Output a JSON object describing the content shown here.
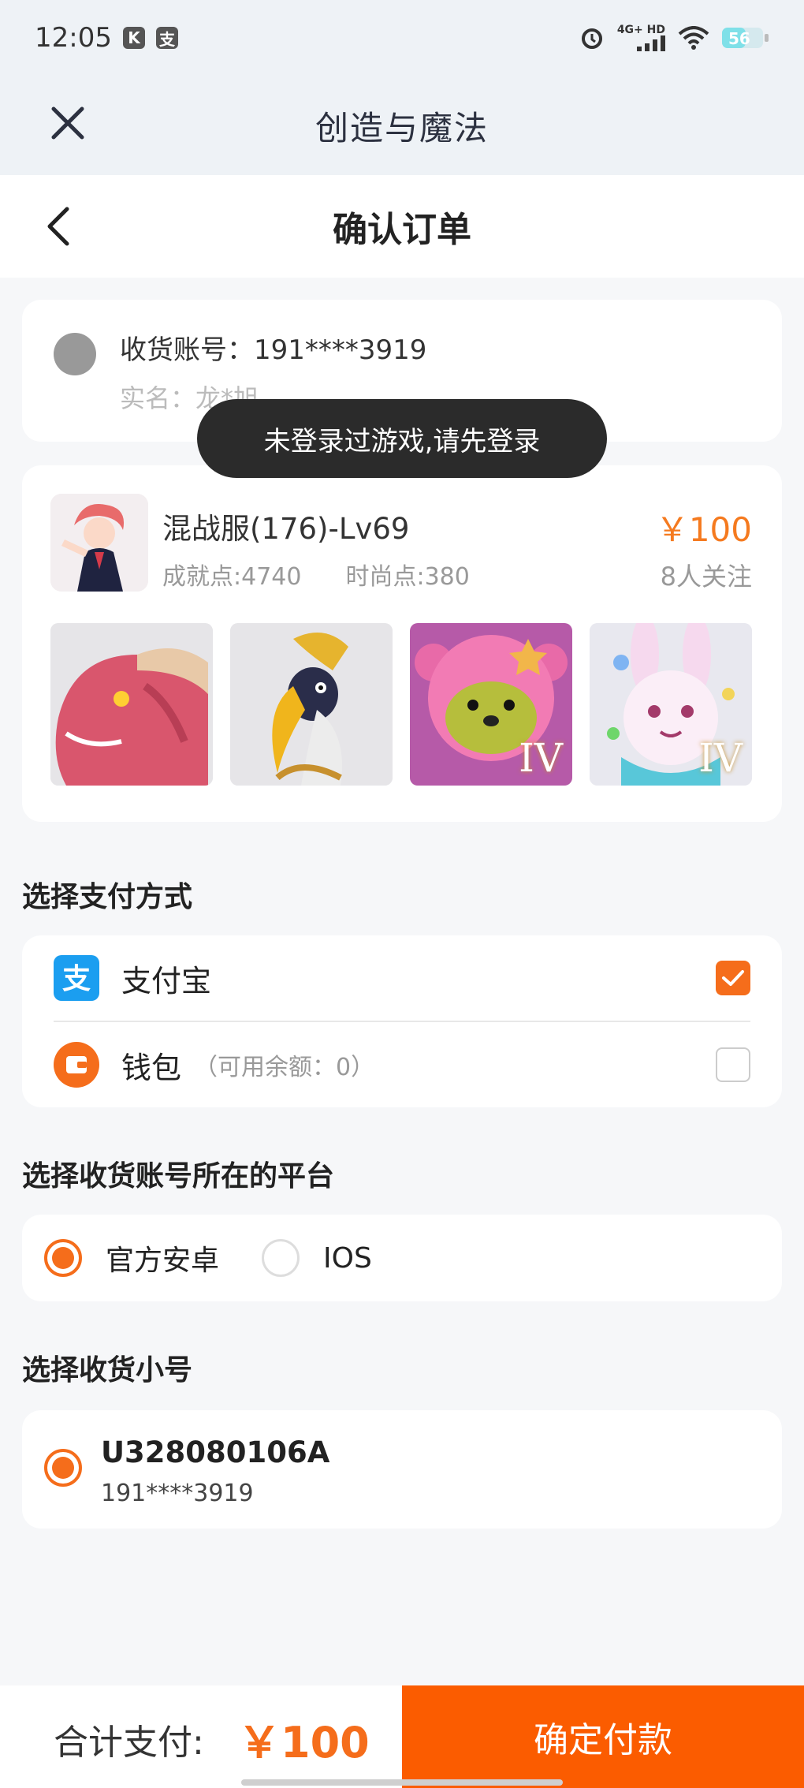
{
  "status_bar": {
    "time": "12:05",
    "badge_k": "K",
    "badge_pay": "支",
    "net_top": "4G+ HD",
    "battery": "56"
  },
  "app_bar": {
    "title": "创造与魔法"
  },
  "header": {
    "title": "确认订单"
  },
  "account": {
    "label": "收货账号：",
    "phone": "191****3919",
    "realname_label": "实名：",
    "realname": "龙*旭"
  },
  "toast": "未登录过游戏,请先登录",
  "product": {
    "name": "混战服(176)-Lv69",
    "achievement": "成就点:4740",
    "fashion": "时尚点:380",
    "price": "￥100",
    "followers": "8人关注",
    "tier_label": "IV",
    "thumb_icons": [
      "dragon-head-icon",
      "toucan-bird-icon",
      "pink-bear-icon",
      "bunny-icon"
    ]
  },
  "payment": {
    "section_title": "选择支付方式",
    "options": [
      {
        "label": "支付宝",
        "sub": "",
        "checked": true,
        "icon": "alipay-icon"
      },
      {
        "label": "钱包",
        "sub": "（可用余额：0）",
        "checked": false,
        "icon": "wallet-icon"
      }
    ]
  },
  "platform": {
    "section_title": "选择收货账号所在的平台",
    "options": [
      {
        "label": "官方安卓",
        "selected": true
      },
      {
        "label": "IOS",
        "selected": false
      }
    ]
  },
  "sub_account": {
    "section_title": "选择收货小号",
    "name": "U328080106A",
    "phone": "191****3919"
  },
  "footer": {
    "total_label": "合计支付:",
    "total_price": "￥100",
    "pay_button": "确定付款"
  },
  "colors": {
    "accent": "#f56d1b",
    "pay_button": "#fb5c00",
    "alipay": "#1b9ef0"
  }
}
